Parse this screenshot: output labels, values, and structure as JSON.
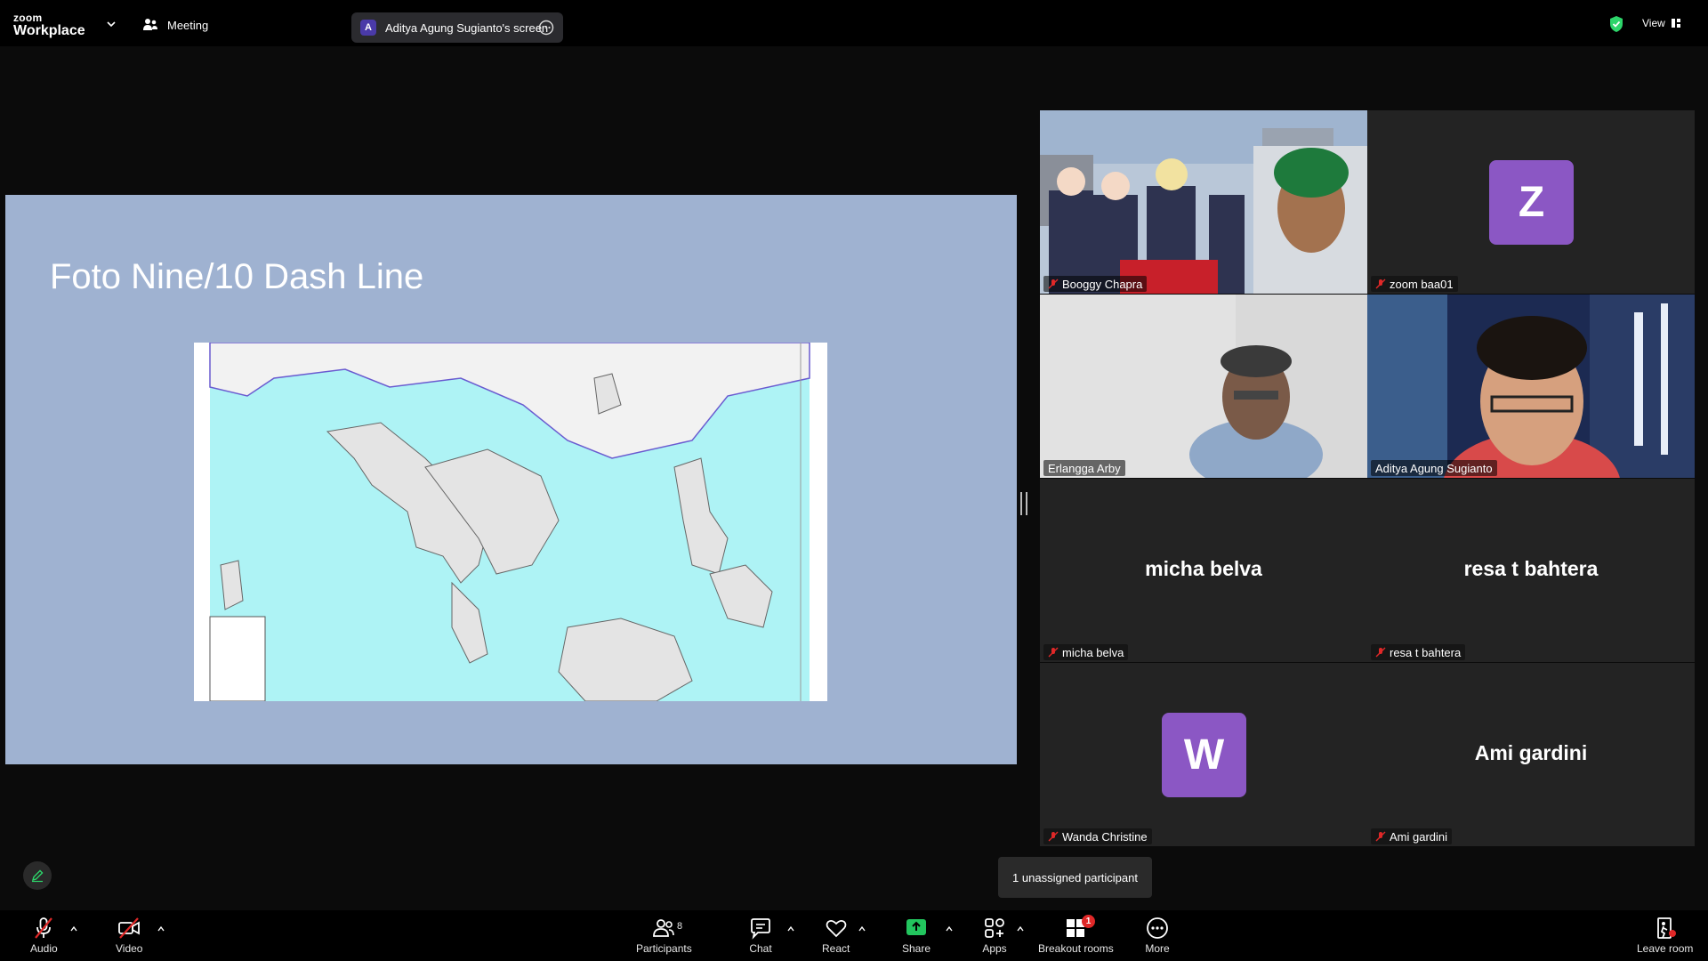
{
  "app": {
    "brand_small": "zoom",
    "brand_large": "Workplace"
  },
  "header": {
    "meeting_label": "Meeting",
    "screen_share_label": "Aditya Agung Sugianto's screen",
    "screen_share_initial": "A",
    "view_label": "View",
    "security_status": "encrypted",
    "accent_color": "#2dd56a"
  },
  "shared_screen": {
    "slide_title": "Foto Nine/10 Dash Line",
    "slide_background": "#9fb2d1"
  },
  "participants": [
    {
      "name": "Booggy Chapra",
      "muted": true,
      "video": true,
      "active_speaker": true
    },
    {
      "name": "zoom baa01",
      "muted": true,
      "video": false,
      "initial": "Z",
      "avatar_color": "#8b57c4"
    },
    {
      "name": "Erlangga Arby",
      "muted": false,
      "video": true
    },
    {
      "name": "Aditya Agung Sugianto",
      "muted": false,
      "video": true
    },
    {
      "name": "micha belva",
      "display_name": "micha belva",
      "muted": true,
      "video": false
    },
    {
      "name": "resa t bahtera",
      "display_name": "resa t bahtera",
      "muted": true,
      "video": false
    },
    {
      "name": "Wanda Christine",
      "muted": true,
      "video": false,
      "initial": "W",
      "avatar_color": "#8b57c4"
    },
    {
      "name": "Ami gardini",
      "display_name": "Ami gardini",
      "muted": true,
      "video": false
    }
  ],
  "tooltip": {
    "text": "1 unassigned participant"
  },
  "toolbar": {
    "audio_label": "Audio",
    "video_label": "Video",
    "participants_label": "Participants",
    "participants_count": "8",
    "chat_label": "Chat",
    "react_label": "React",
    "share_label": "Share",
    "apps_label": "Apps",
    "breakout_label": "Breakout rooms",
    "breakout_badge": "1",
    "more_label": "More",
    "leave_label": "Leave room",
    "share_color": "#22c55e",
    "leave_color": "#e02828"
  }
}
